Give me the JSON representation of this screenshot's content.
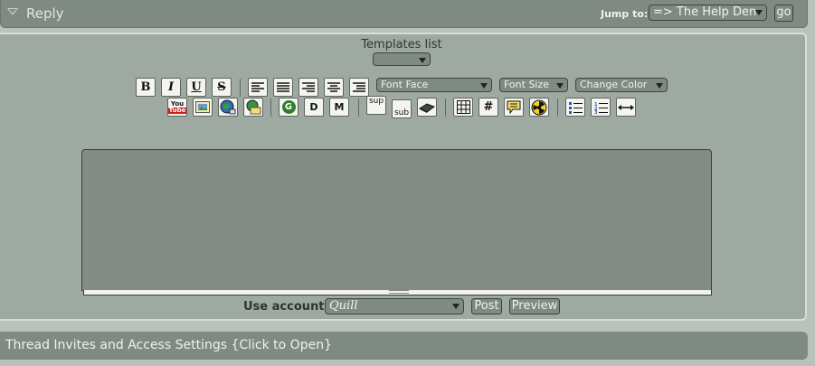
{
  "reply": {
    "title": "Reply",
    "jump_label": "Jump to:",
    "jump_value": "=> The Help Den",
    "go_label": "go"
  },
  "templates": {
    "label": "Templates list",
    "value": ""
  },
  "toolbar": {
    "bold": "B",
    "italic": "I",
    "underline": "U",
    "strike": "S",
    "font_face": "Font Face",
    "font_size": "Font Size",
    "change_color": "Change Color",
    "youtube_top": "You",
    "youtube_bottom": "Tube",
    "google": "G",
    "d_label": "D",
    "m_label": "M",
    "sup": "sup",
    "sub": "sub",
    "hash": "#"
  },
  "smileys": [
    "=^.^=",
    "=^.^=",
    "=^.^=",
    "=^.^=",
    "grin",
    "face",
    "=^.^=",
    "=^.^=",
    "=^.^=",
    "=^.^=",
    "=^.^=",
    "=^.^=",
    "=^.^=",
    "=^.^=",
    "=^.^=",
    "=^.^=",
    "devil",
    "=^.^="
  ],
  "message": {
    "value": ""
  },
  "account": {
    "label": "Use account:",
    "value": "Quill"
  },
  "buttons": {
    "post": "Post",
    "preview": "Preview"
  },
  "thread": {
    "title": "Thread Invites and Access Settings {Click to Open}"
  }
}
